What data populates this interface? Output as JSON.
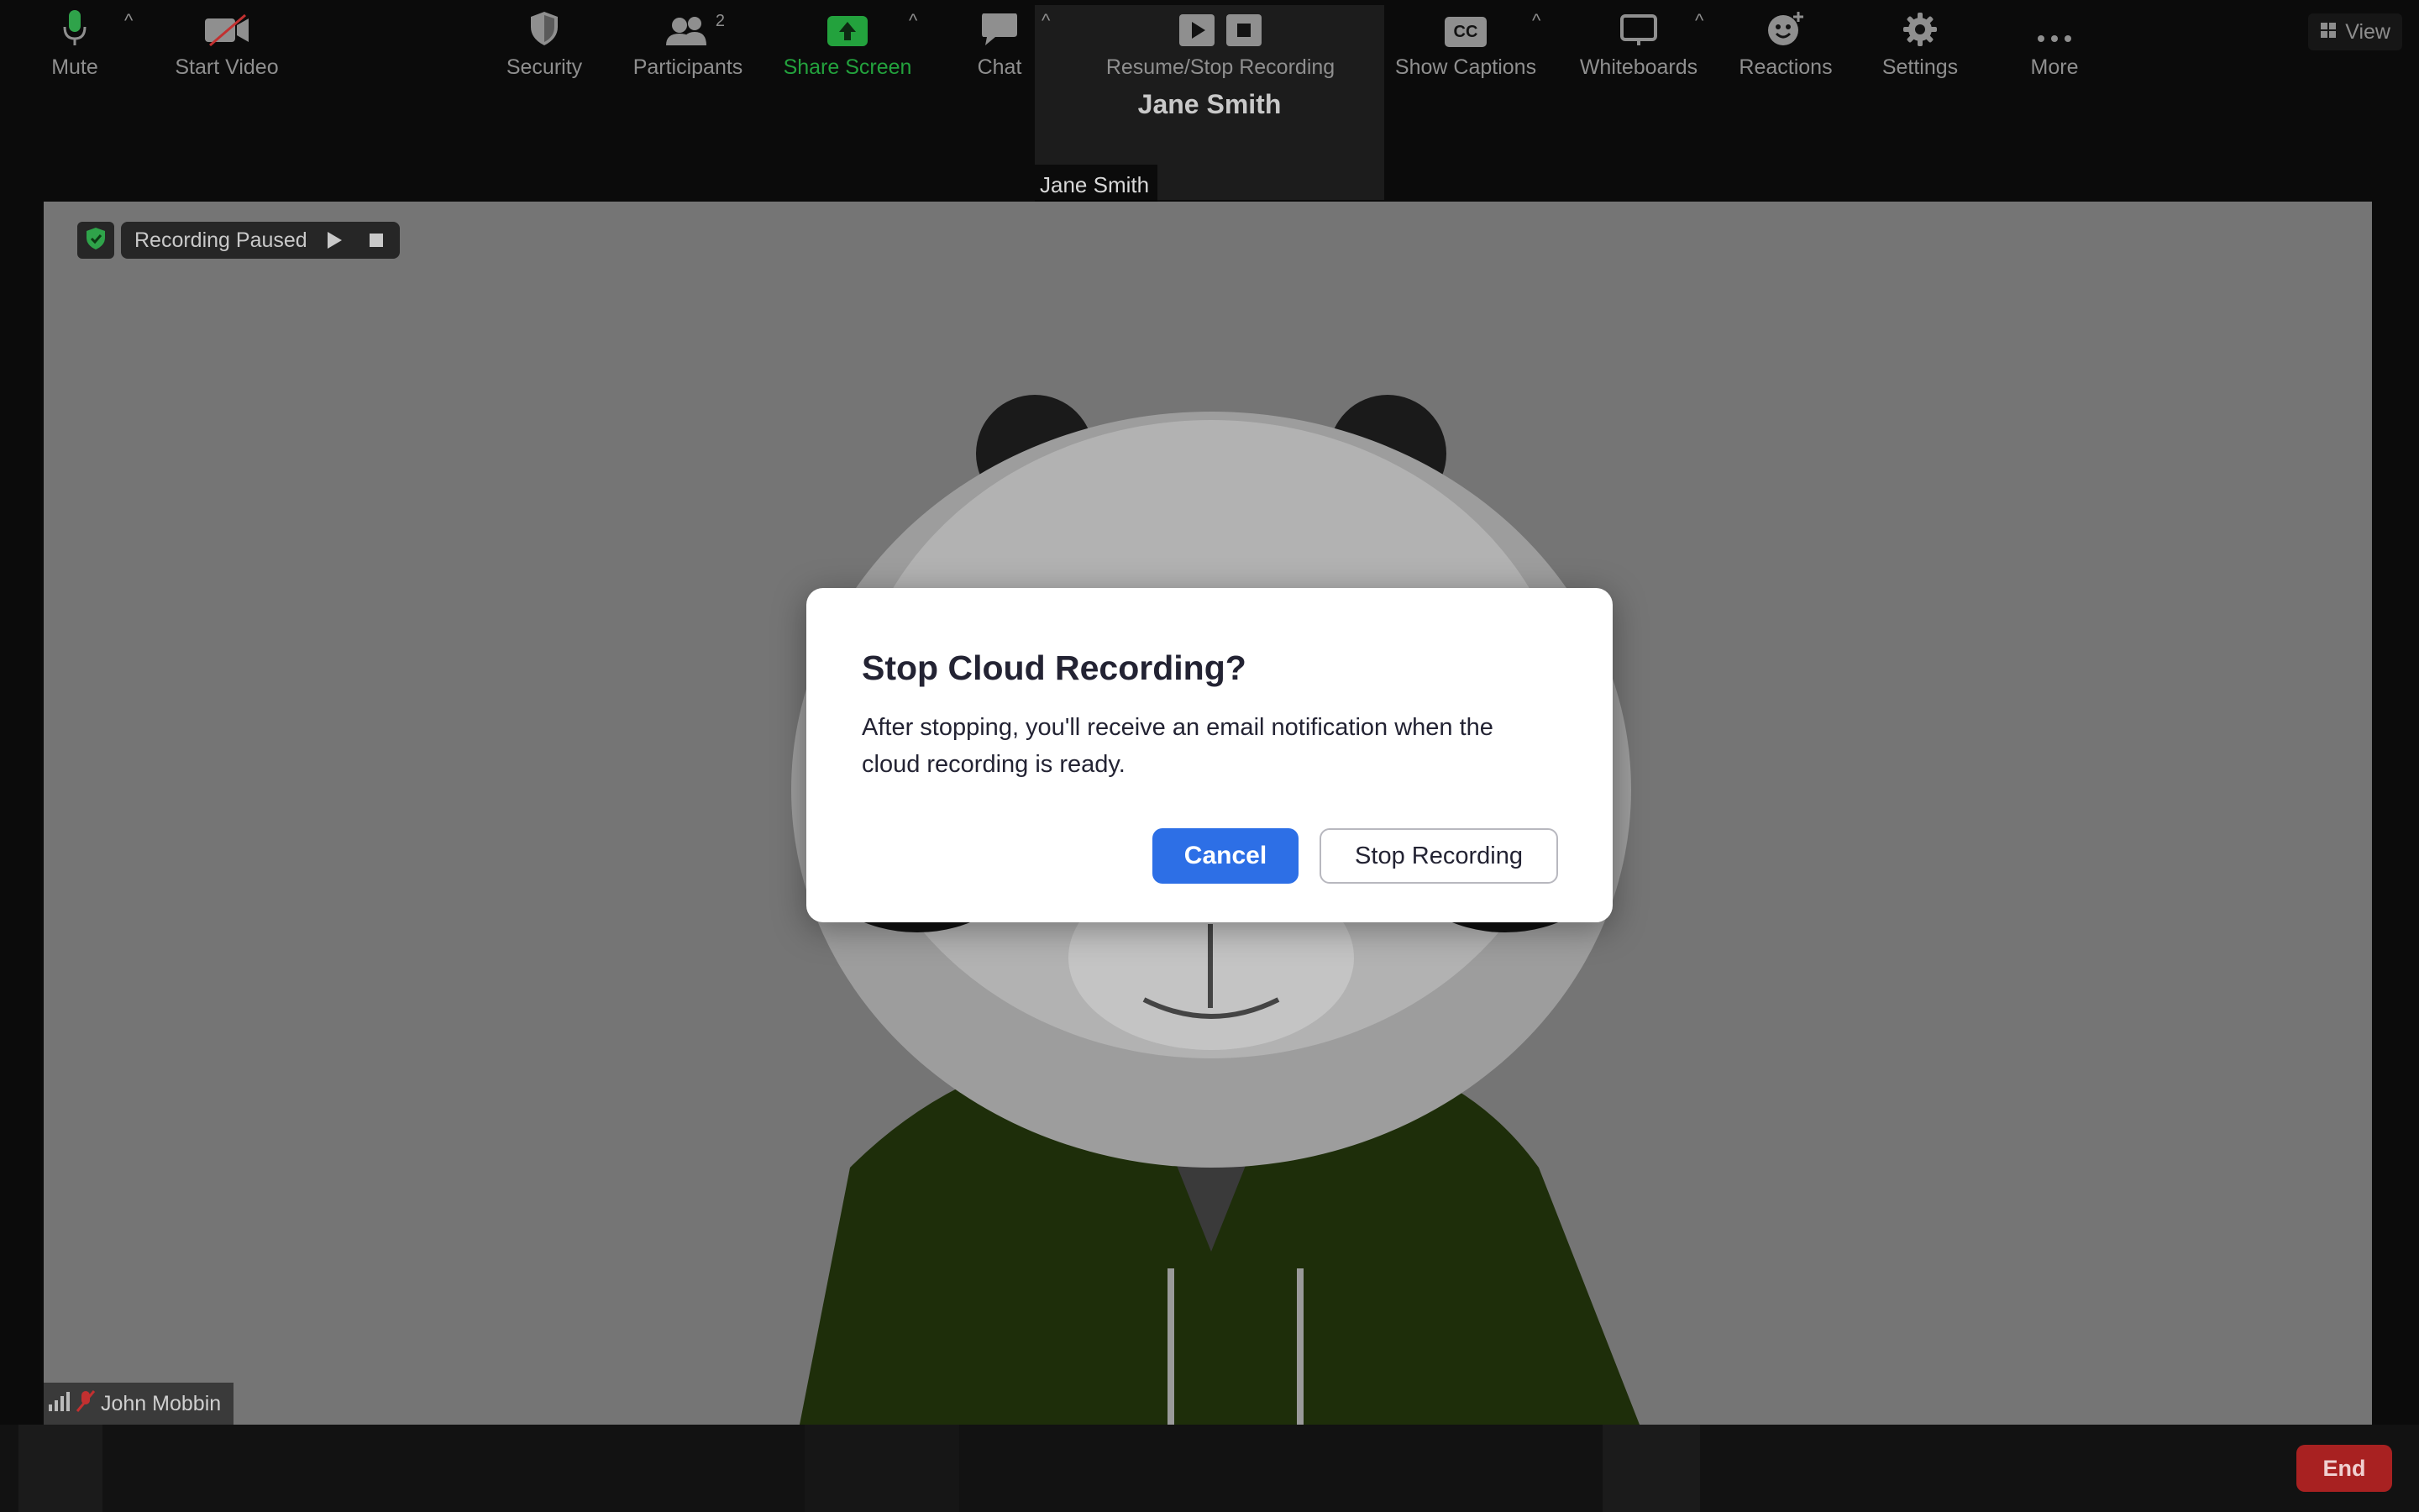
{
  "top_tile": {
    "center_name": "Jane Smith",
    "name_tag": "Jane Smith"
  },
  "view_button": {
    "label": "View",
    "icon": "grid-icon"
  },
  "recording_status": {
    "label": "Recording Paused",
    "shield_color": "#2fa34a"
  },
  "main_video": {
    "participant_name": "John Mobbin"
  },
  "dialog": {
    "title": "Stop Cloud Recording?",
    "body": "After stopping, you'll receive an email notification when the cloud recording is ready.",
    "cancel_label": "Cancel",
    "stop_label": "Stop Recording",
    "accent": "#2d6fe6"
  },
  "toolbar": {
    "mute": "Mute",
    "start_video": "Start Video",
    "security": "Security",
    "participants": "Participants",
    "participants_count": "2",
    "share_screen": "Share Screen",
    "chat": "Chat",
    "resume_stop_recording": "Resume/Stop Recording",
    "show_captions": "Show Captions",
    "captions_icon_text": "CC",
    "whiteboards": "Whiteboards",
    "reactions": "Reactions",
    "settings": "Settings",
    "more": "More",
    "end": "End",
    "share_color": "#23a23d",
    "end_color": "#a82121"
  }
}
